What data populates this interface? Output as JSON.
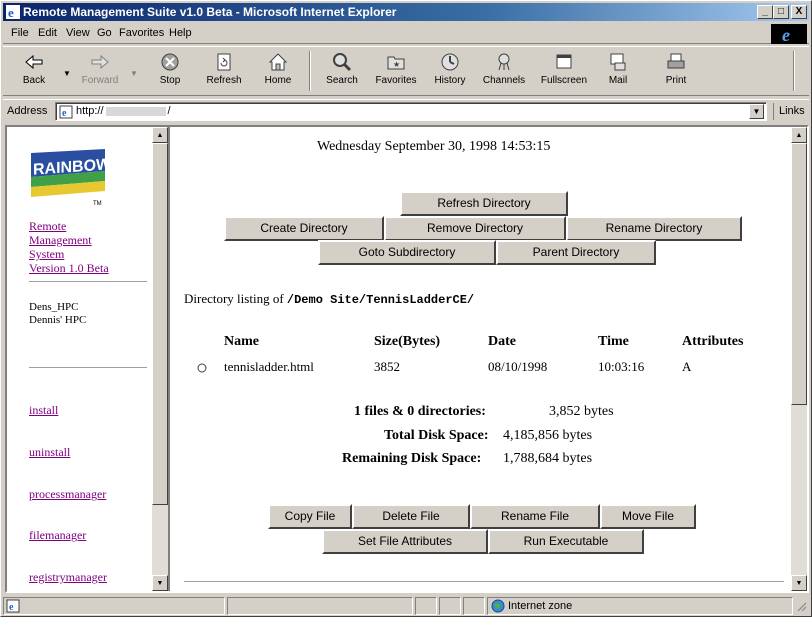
{
  "window": {
    "title": "Remote Management Suite v1.0 Beta - Microsoft Internet Explorer",
    "min": "_",
    "max": "□",
    "close": "X"
  },
  "menu": [
    "File",
    "Edit",
    "View",
    "Go",
    "Favorites",
    "Help"
  ],
  "toolbar": {
    "back": "Back",
    "forward": "Forward",
    "stop": "Stop",
    "refresh": "Refresh",
    "home": "Home",
    "search": "Search",
    "favorites": "Favorites",
    "history": "History",
    "channels": "Channels",
    "fullscreen": "Fullscreen",
    "mail": "Mail",
    "print": "Print"
  },
  "address": {
    "label": "Address",
    "value": "http://",
    "value_suffix": "/",
    "links": "Links"
  },
  "left": {
    "logo_text": "RAINBOW",
    "logo_tm": "TM",
    "system_link": [
      "Remote",
      "Management",
      "System",
      "Version 1.0 Beta"
    ],
    "devices": [
      "Dens_HPC",
      "Dennis' HPC"
    ],
    "nav": [
      "install",
      "uninstall",
      "processmanager",
      "filemanager",
      "registrymanager"
    ]
  },
  "main": {
    "datetime": "Wednesday September 30, 1998 14:53:15",
    "buttons_dir": {
      "refresh": "Refresh Directory",
      "create": "Create Directory",
      "remove": "Remove Directory",
      "rename": "Rename Directory",
      "goto": "Goto Subdirectory",
      "parent": "Parent Directory"
    },
    "listing_label": "Directory listing of",
    "listing_path": "/Demo Site/TennisLadderCE/",
    "columns": [
      "Name",
      "Size(Bytes)",
      "Date",
      "Time",
      "Attributes"
    ],
    "files": [
      {
        "name": "tennisladder.html",
        "size": "3852",
        "date": "08/10/1998",
        "time": "10:03:16",
        "attr": "A"
      }
    ],
    "summary": {
      "count_label": "1 files & 0 directories:",
      "count_value": "3,852 bytes",
      "total_label": "Total Disk Space:",
      "total_value": "4,185,856 bytes",
      "remaining_label": "Remaining Disk Space:",
      "remaining_value": "1,788,684 bytes"
    },
    "buttons_file": {
      "copy": "Copy File",
      "delete": "Delete File",
      "rename": "Rename File",
      "move": "Move File",
      "attrs": "Set File Attributes",
      "run": "Run Executable"
    }
  },
  "status": {
    "zone": "Internet zone"
  }
}
